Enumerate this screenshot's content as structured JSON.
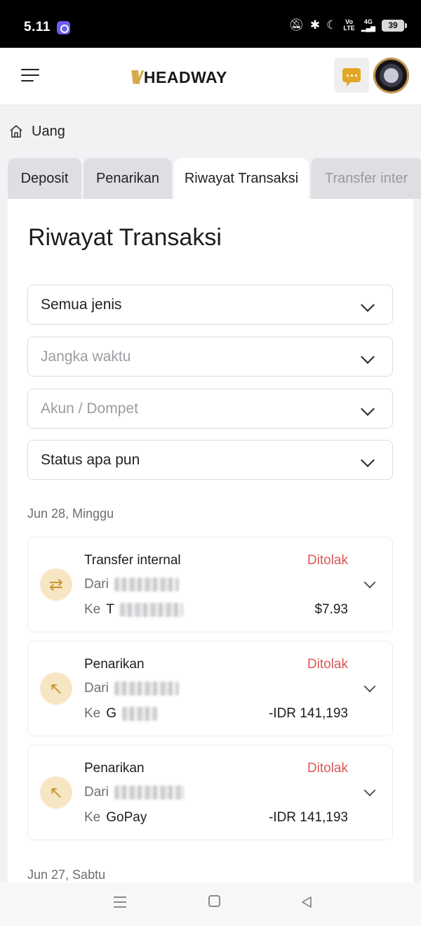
{
  "status_bar": {
    "time": "5.11",
    "battery": "39",
    "network_top": "Vo",
    "network_bottom": "LTE",
    "signal": "4G"
  },
  "header": {
    "logo_text": "HEADWAY",
    "logo_mark": "\\\\\\/",
    "brand_color": "#d3a542"
  },
  "breadcrumb": {
    "label": "Uang"
  },
  "tabs": [
    {
      "label": "Deposit"
    },
    {
      "label": "Penarikan"
    },
    {
      "label": "Riwayat Transaksi"
    },
    {
      "label": "Transfer inter"
    }
  ],
  "active_tab": "Riwayat Transaksi",
  "page_title": "Riwayat Transaksi",
  "filters": {
    "type": {
      "value": "Semua jenis"
    },
    "period": {
      "placeholder": "Jangka waktu"
    },
    "account": {
      "placeholder": "Akun / Dompet"
    },
    "status": {
      "value": "Status apa pun"
    }
  },
  "groups": [
    {
      "date": "Jun 28, Minggu",
      "transactions": [
        {
          "type": "Transfer internal",
          "status": "Ditolak",
          "from_label": "Dari",
          "to_label": "Ke",
          "to_value": "T",
          "amount": "$7.93",
          "icon": "transfer-arrows-icon"
        },
        {
          "type": "Penarikan",
          "status": "Ditolak",
          "from_label": "Dari",
          "to_label": "Ke",
          "to_value": "G",
          "amount": "-IDR 141,193",
          "icon": "withdraw-arrow-icon"
        },
        {
          "type": "Penarikan",
          "status": "Ditolak",
          "from_label": "Dari",
          "to_label": "Ke",
          "to_value": "GoPay",
          "amount": "-IDR 141,193",
          "icon": "withdraw-arrow-icon"
        }
      ]
    },
    {
      "date": "Jun 27, Sabtu",
      "transactions": []
    }
  ],
  "colors": {
    "rejected": "#d95757",
    "icon_bg": "#f7e6c4",
    "icon_fg": "#c9952f"
  }
}
